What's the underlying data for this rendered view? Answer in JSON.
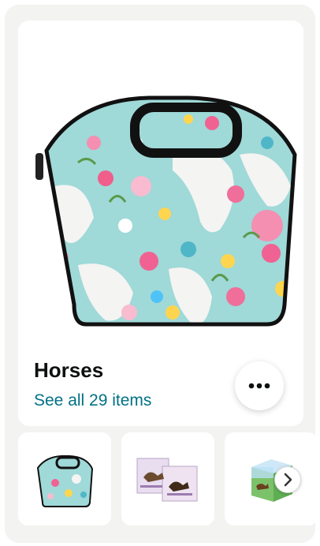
{
  "collection": {
    "title": "Horses",
    "see_all_label": "See all 29 items"
  },
  "icons": {
    "more": "more-options-icon",
    "next": "chevron-right-icon"
  },
  "colors": {
    "link": "#007185",
    "bag_base": "#9fd9d8",
    "bag_trim": "#111111"
  }
}
